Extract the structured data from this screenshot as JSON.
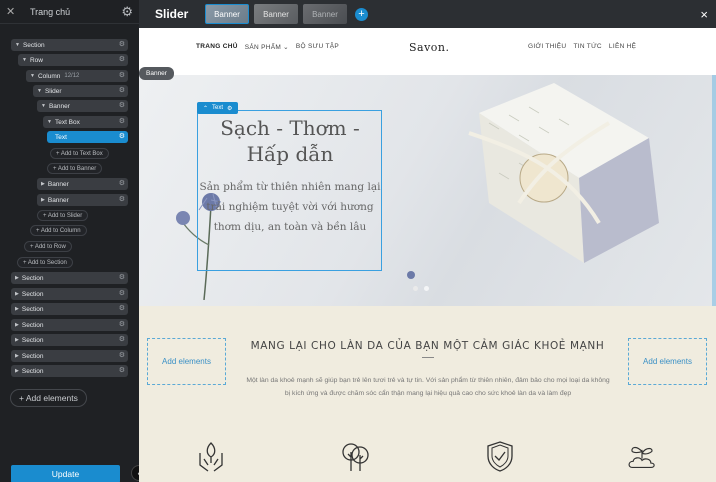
{
  "sidebar": {
    "title": "Trang chủ",
    "nodes": [
      {
        "label": "Section"
      },
      {
        "label": "Row"
      },
      {
        "label": "Column",
        "meta": "12/12"
      },
      {
        "label": "Slider"
      },
      {
        "label": "Banner"
      },
      {
        "label": "Text Box"
      },
      {
        "label": "Text"
      },
      {
        "label": "Banner"
      },
      {
        "label": "Banner"
      },
      {
        "label": "Section"
      },
      {
        "label": "Section"
      },
      {
        "label": "Section"
      },
      {
        "label": "Section"
      },
      {
        "label": "Section"
      },
      {
        "label": "Section"
      },
      {
        "label": "Section"
      }
    ],
    "add_buttons": [
      "+ Add to Text Box",
      "+ Add to Banner",
      "+ Add to Slider",
      "+ Add to Column",
      "+ Add to Row",
      "+ Add to Section"
    ],
    "add_elements": "+ Add elements",
    "update": "Update"
  },
  "topbar": {
    "title": "Slider",
    "tabs": [
      "Banner",
      "Banner",
      "Banner"
    ],
    "close": "×"
  },
  "site": {
    "nav_left": [
      "TRANG CHỦ",
      "SẢN PHẨM ⌄",
      "BỘ SƯU TẬP"
    ],
    "logo": "Savon.",
    "nav_right": [
      "GIỚI THIỆU",
      "TIN TỨC",
      "LIÊN HỆ"
    ]
  },
  "hero": {
    "banner_tag": "Banner",
    "text_tag": "Text",
    "heading": "Sạch - Thơm - Hấp dẫn",
    "paragraph": "Sản phẩm từ thiên nhiên mang lại trải nghiệm tuyệt vời với hương thơm dịu, an toàn và bền lâu"
  },
  "section2": {
    "add_elements_left": "Add elements",
    "add_elements_right": "Add elements",
    "heading": "MANG LẠI CHO LÀN DA CỦA BẠN MỘT CẢM GIÁC KHOẺ MẠNH",
    "paragraph": "Một làn da khoẻ mạnh sẽ giúp bạn trẻ lên tươi trẻ và tự tin. Với sản phẩm từ thiên nhiên, đảm bảo cho mọi loại da không bị kích ứng và được chăm sóc cẩn thận mang lại hiệu quả cao cho sức khoẻ làn da và làm đẹp"
  },
  "colors": {
    "accent": "#1a8ccf",
    "sidebar_bg": "#1f2124",
    "section_bg": "#f0ecdf"
  }
}
